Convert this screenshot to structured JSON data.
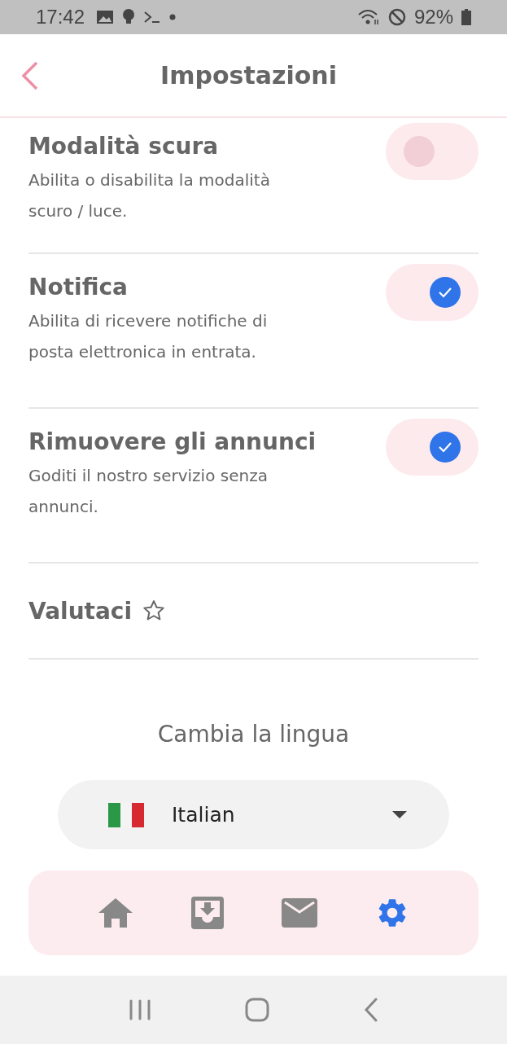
{
  "status_bar": {
    "time": "17:42",
    "battery": "92%"
  },
  "header": {
    "title": "Impostazioni"
  },
  "settings": [
    {
      "kind": "toggle",
      "title": "Modalità scura",
      "description": "Abilita o disabilita la modalità scuro / luce.",
      "on": false
    },
    {
      "kind": "toggle",
      "title": "Notifica",
      "description": "Abilita di ricevere notifiche di posta elettronica in entrata.",
      "on": true
    },
    {
      "kind": "toggle",
      "title": "Rimuovere gli annunci",
      "description": "Goditi il nostro servizio senza annunci.",
      "on": true
    },
    {
      "kind": "rate",
      "title": "Valutaci"
    }
  ],
  "language": {
    "label": "Cambia la lingua",
    "value": "Italian"
  },
  "bottom_nav": [
    {
      "kind": "home",
      "selected": false
    },
    {
      "kind": "inbox",
      "selected": false
    },
    {
      "kind": "mail",
      "selected": false
    },
    {
      "kind": "settings",
      "selected": true
    }
  ]
}
